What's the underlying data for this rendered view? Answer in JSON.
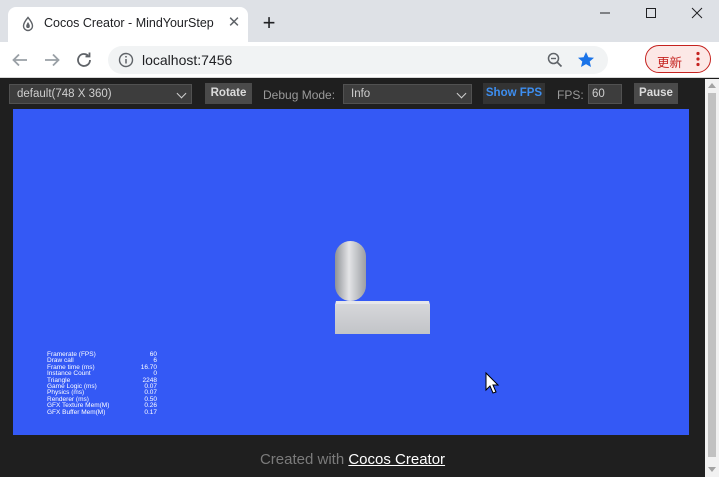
{
  "browser": {
    "tab_title": "Cocos Creator - MindYourStep",
    "new_tab_icon": "plus-icon",
    "window_controls": [
      "minimize-icon",
      "maximize-icon",
      "close-icon"
    ],
    "url": "localhost:7456",
    "update_label": "更新",
    "colors": {
      "update_accent": "#c5221f",
      "bookmark_star": "#1a73e8"
    }
  },
  "preview": {
    "device_select": "default(748 X 360)",
    "rotate_label": "Rotate",
    "debug_mode_label": "Debug Mode:",
    "debug_mode_value": "Info",
    "show_fps_label": "Show FPS",
    "fps_label": "FPS:",
    "fps_value": "60",
    "pause_label": "Pause",
    "canvas_color": "#3459f5",
    "stats": [
      {
        "name": "Framerate (FPS)",
        "value": "60"
      },
      {
        "name": "Draw call",
        "value": "6"
      },
      {
        "name": "Frame time (ms)",
        "value": "16.70"
      },
      {
        "name": "Instance Count",
        "value": "0"
      },
      {
        "name": "Triangle",
        "value": "2248"
      },
      {
        "name": "Game Logic (ms)",
        "value": "0.07"
      },
      {
        "name": "Physics (ms)",
        "value": "0.07"
      },
      {
        "name": "Renderer (ms)",
        "value": "0.50"
      },
      {
        "name": "GFX Texture Mem(M)",
        "value": "0.26"
      },
      {
        "name": "GFX Buffer Mem(M)",
        "value": "0.17"
      }
    ]
  },
  "footer": {
    "prefix": "Created with",
    "link": "Cocos Creator"
  }
}
